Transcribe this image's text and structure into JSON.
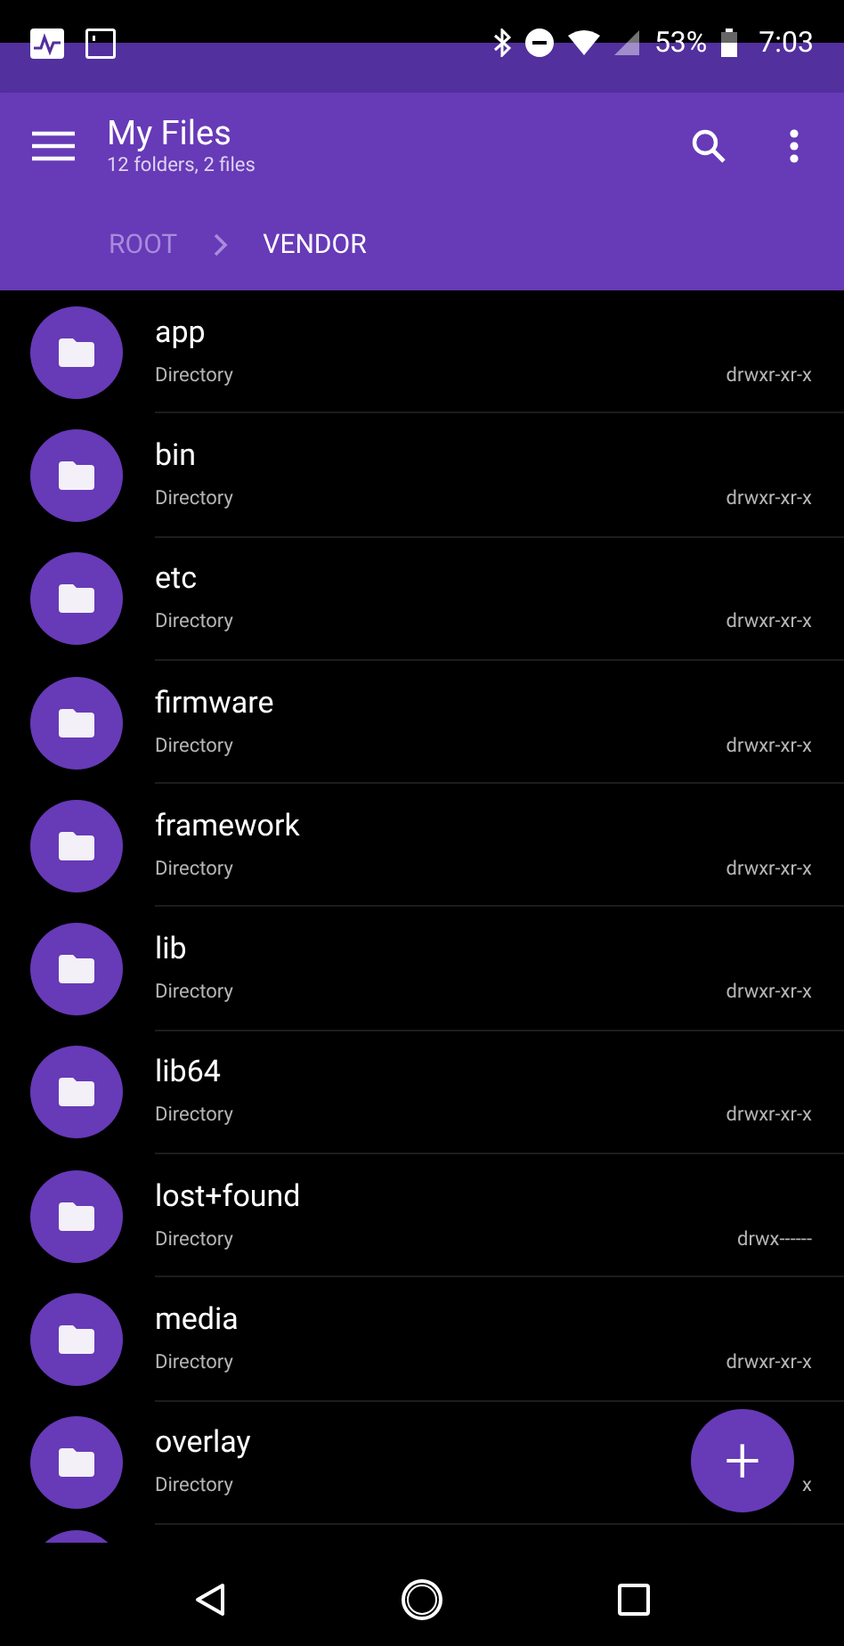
{
  "status_bar": {
    "battery": "53%",
    "time": "7:03"
  },
  "app_bar": {
    "title": "My Files",
    "subtitle": "12 folders, 2 files"
  },
  "breadcrumbs": [
    {
      "label": "ROOT",
      "selected": false
    },
    {
      "label": "VENDOR",
      "selected": true
    }
  ],
  "items": [
    {
      "name": "app",
      "type": "Directory",
      "permissions": "drwxr-xr-x"
    },
    {
      "name": "bin",
      "type": "Directory",
      "permissions": "drwxr-xr-x"
    },
    {
      "name": "etc",
      "type": "Directory",
      "permissions": "drwxr-xr-x"
    },
    {
      "name": "firmware",
      "type": "Directory",
      "permissions": "drwxr-xr-x"
    },
    {
      "name": "framework",
      "type": "Directory",
      "permissions": "drwxr-xr-x"
    },
    {
      "name": "lib",
      "type": "Directory",
      "permissions": "drwxr-xr-x"
    },
    {
      "name": "lib64",
      "type": "Directory",
      "permissions": "drwxr-xr-x"
    },
    {
      "name": "lost+found",
      "type": "Directory",
      "permissions": "drwx------"
    },
    {
      "name": "media",
      "type": "Directory",
      "permissions": "drwxr-xr-x"
    },
    {
      "name": "overlay",
      "type": "Directory",
      "permissions": "x"
    }
  ],
  "more_below": true,
  "fab": {
    "label": "+"
  }
}
